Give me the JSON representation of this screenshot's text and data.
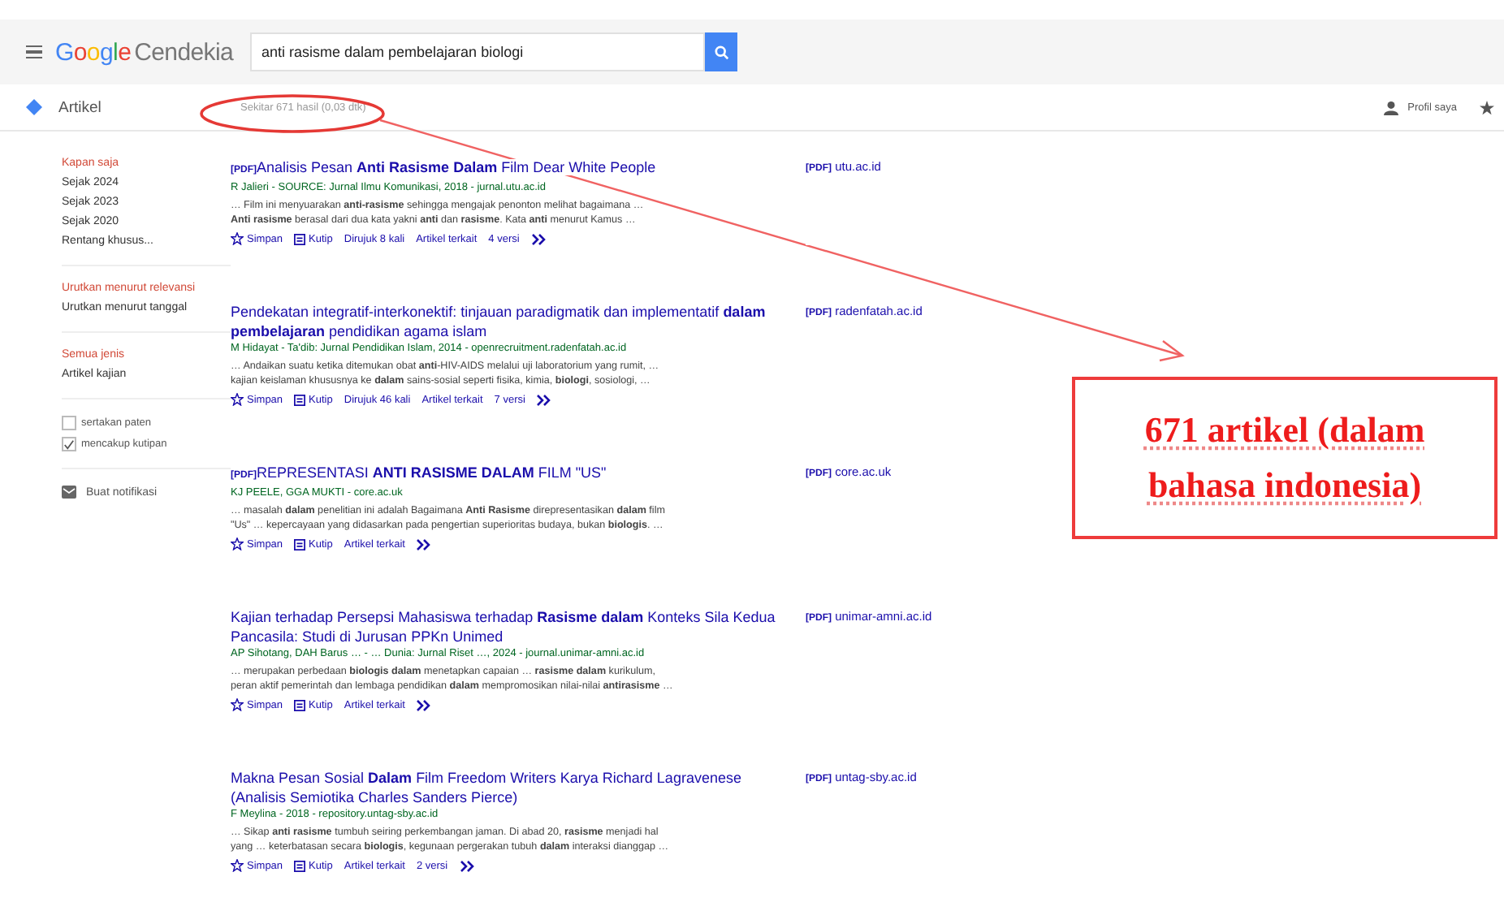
{
  "header": {
    "logo": {
      "brand": "Google",
      "product": "Cendekia"
    },
    "search": {
      "value": "anti rasisme dalam pembelajaran biologi"
    }
  },
  "subbar": {
    "section": "Artikel",
    "result_count": "Sekitar 671 hasil (0,03 dtk)",
    "profile": "Profil saya"
  },
  "sidebar": {
    "groups": [
      [
        {
          "label": "Kapan saja",
          "selected": true
        },
        {
          "label": "Sejak 2024",
          "selected": false
        },
        {
          "label": "Sejak 2023",
          "selected": false
        },
        {
          "label": "Sejak 2020",
          "selected": false
        },
        {
          "label": "Rentang khusus...",
          "selected": false
        }
      ],
      [
        {
          "label": "Urutkan menurut relevansi",
          "selected": true
        },
        {
          "label": "Urutkan menurut tanggal",
          "selected": false
        }
      ],
      [
        {
          "label": "Semua jenis",
          "selected": true
        },
        {
          "label": "Artikel kajian",
          "selected": false
        }
      ]
    ],
    "checkboxes": [
      {
        "label": "sertakan paten",
        "checked": false
      },
      {
        "label": "mencakup kutipan",
        "checked": true
      }
    ],
    "alert": "Buat notifikasi"
  },
  "results": [
    {
      "pdf_tag": "[PDF]",
      "title": "Analisis Pesan **Anti Rasisme Dalam** Film Dear White People",
      "meta": "R Jalieri - SOURCE: Jurnal Ilmu Komunikasi, 2018 - jurnal.utu.ac.id",
      "snippet": [
        "… Film ini menyuarakan **anti-rasisme** sehingga mengajak penonton melihat bagaimana …",
        "**Anti rasisme** berasal dari dua kata yakni **anti** dan **rasisme**. Kata **anti** menurut Kamus …"
      ],
      "actions": [
        {
          "kind": "save",
          "label": "Simpan"
        },
        {
          "kind": "cite",
          "label": "Kutip"
        },
        {
          "kind": "link",
          "label": "Dirujuk 8 kali"
        },
        {
          "kind": "link",
          "label": "Artikel terkait"
        },
        {
          "kind": "link",
          "label": "4 versi"
        },
        {
          "kind": "more"
        }
      ],
      "source_tag": "[PDF]",
      "source": "utu.ac.id"
    },
    {
      "title": "Pendekatan integratif-interkonektif: tinjauan paradigmatik dan implementatif **dalam pembelajaran** pendidikan agama islam",
      "meta": "M Hidayat - Ta'dib: Jurnal Pendidikan Islam, 2014 - openrecruitment.radenfatah.ac.id",
      "snippet": [
        "… Andaikan suatu ketika ditemukan obat **anti**-HIV-AIDS melalui uji laboratorium yang rumit, …",
        "kajian keislaman khususnya ke **dalam** sains-sosial seperti fisika, kimia, **biologi**, sosiologi, …"
      ],
      "actions": [
        {
          "kind": "save",
          "label": "Simpan"
        },
        {
          "kind": "cite",
          "label": "Kutip"
        },
        {
          "kind": "link",
          "label": "Dirujuk 46 kali"
        },
        {
          "kind": "link",
          "label": "Artikel terkait"
        },
        {
          "kind": "link",
          "label": "7 versi"
        },
        {
          "kind": "more"
        }
      ],
      "source_tag": "[PDF]",
      "source": "radenfatah.ac.id"
    },
    {
      "pdf_tag": "[PDF]",
      "title": "REPRESENTASI **ANTI RASISME DALAM** FILM \"US\"",
      "meta": "KJ PEELE, GGA MUKTI - core.ac.uk",
      "snippet": [
        "… masalah **dalam** penelitian ini adalah Bagaimana **Anti Rasisme** direpresentasikan **dalam** film",
        "\"Us\" … kepercayaan yang didasarkan pada pengertian superioritas budaya, bukan **biologis**. …"
      ],
      "actions": [
        {
          "kind": "save",
          "label": "Simpan"
        },
        {
          "kind": "cite",
          "label": "Kutip"
        },
        {
          "kind": "link",
          "label": "Artikel terkait"
        },
        {
          "kind": "more"
        }
      ],
      "source_tag": "[PDF]",
      "source": "core.ac.uk"
    },
    {
      "title": "Kajian terhadap Persepsi Mahasiswa terhadap **Rasisme dalam** Konteks Sila Kedua Pancasila: Studi di Jurusan PPKn Unimed",
      "meta": "AP Sihotang, DAH Barus … - … Dunia: Jurnal Riset …, 2024 - journal.unimar-amni.ac.id",
      "snippet": [
        "… merupakan perbedaan **biologis dalam** menetapkan capaian … **rasisme dalam** kurikulum,",
        "peran aktif pemerintah dan lembaga pendidikan **dalam** mempromosikan nilai-nilai **antirasisme** …"
      ],
      "actions": [
        {
          "kind": "save",
          "label": "Simpan"
        },
        {
          "kind": "cite",
          "label": "Kutip"
        },
        {
          "kind": "link",
          "label": "Artikel terkait"
        },
        {
          "kind": "more"
        }
      ],
      "source_tag": "[PDF]",
      "source": "unimar-amni.ac.id"
    },
    {
      "title": "Makna Pesan Sosial **Dalam** Film Freedom Writers Karya Richard Lagravenese (Analisis Semiotika Charles Sanders Pierce)",
      "meta": "F Meylina - 2018 - repository.untag-sby.ac.id",
      "snippet": [
        "… Sikap **anti rasisme** tumbuh seiring perkembangan jaman. Di abad 20, **rasisme** menjadi hal",
        "yang … keterbatasan secara **biologis**, kegunaan pergerakan tubuh **dalam** interaksi dianggap …"
      ],
      "actions": [
        {
          "kind": "save",
          "label": "Simpan"
        },
        {
          "kind": "cite",
          "label": "Kutip"
        },
        {
          "kind": "link",
          "label": "Artikel terkait"
        },
        {
          "kind": "link",
          "label": "2 versi"
        },
        {
          "kind": "more"
        }
      ],
      "source_tag": "[PDF]",
      "source": "untag-sby.ac.id"
    }
  ],
  "annotation": {
    "text": "671 artikel (dalam bahasa indonesia)"
  }
}
